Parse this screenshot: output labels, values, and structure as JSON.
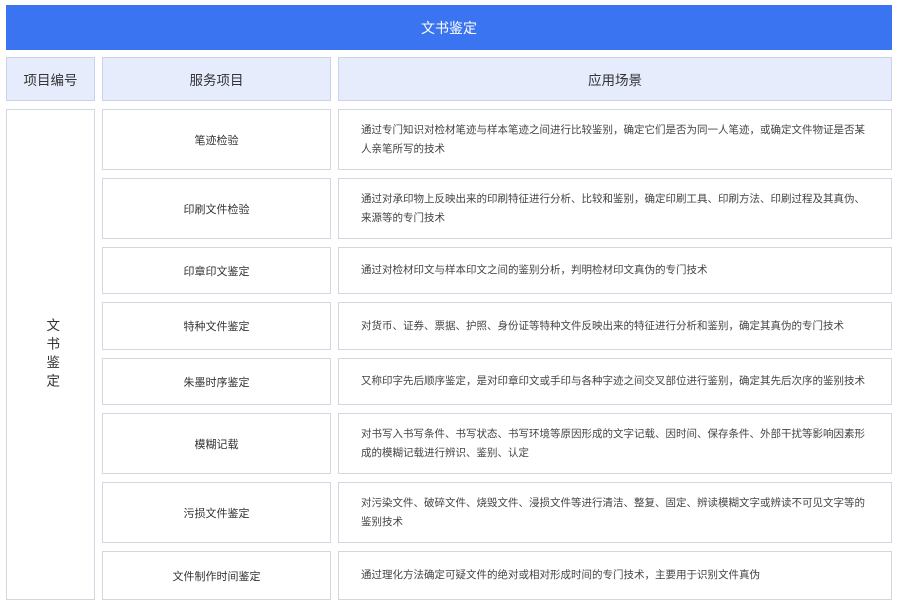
{
  "title": "文书鉴定",
  "headers": {
    "col1": "项目编号",
    "col2": "服务项目",
    "col3": "应用场景"
  },
  "category": "文书鉴定",
  "rows": [
    {
      "service": "笔迹检验",
      "scenario": "通过专门知识对检材笔迹与样本笔迹之间进行比较鉴别，确定它们是否为同一人笔迹，或确定文件物证是否某人亲笔所写的技术"
    },
    {
      "service": "印刷文件检验",
      "scenario": "通过对承印物上反映出来的印刷特征进行分析、比较和鉴别，确定印刷工具、印刷方法、印刷过程及其真伪、来源等的专门技术"
    },
    {
      "service": "印章印文鉴定",
      "scenario": "通过对检材印文与样本印文之间的鉴别分析，判明检材印文真伪的专门技术"
    },
    {
      "service": "特种文件鉴定",
      "scenario": "对货币、证券、票据、护照、身份证等特种文件反映出来的特征进行分析和鉴别，确定其真伪的专门技术"
    },
    {
      "service": "朱墨时序鉴定",
      "scenario": "又称印字先后顺序鉴定，是对印章印文或手印与各种字迹之间交叉部位进行鉴别，确定其先后次序的鉴别技术"
    },
    {
      "service": "模糊记载",
      "scenario": "对书写入书写条件、书写状态、书写环境等原因形成的文字记载、因时间、保存条件、外部干扰等影响因素形成的模糊记载进行辨识、鉴别、认定"
    },
    {
      "service": "污损文件鉴定",
      "scenario": "对污染文件、破碎文件、烧毁文件、浸损文件等进行清洁、整复、固定、辨读模糊文字或辨读不可见文字等的鉴别技术"
    },
    {
      "service": "文件制作时间鉴定",
      "scenario": "通过理化方法确定可疑文件的绝对或相对形成时间的专门技术，主要用于识别文件真伪"
    }
  ]
}
